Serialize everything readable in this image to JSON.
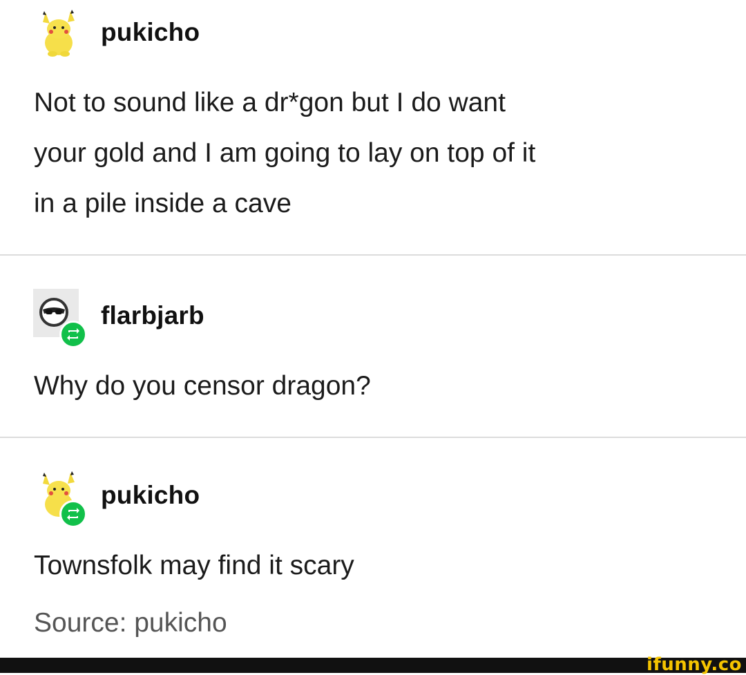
{
  "posts": [
    {
      "username": "pukicho",
      "avatar": "pikachu-plush-avatar",
      "reblogged": false,
      "text_lines": [
        "Not to sound like a dr*gon but I do want",
        "your gold and I am going to lay on top of it",
        "in a pile inside a cave"
      ]
    },
    {
      "username": "flarbjarb",
      "avatar": "sunglasses-emoji-avatar",
      "reblogged": true,
      "text_lines": [
        "Why do you censor dragon?"
      ]
    },
    {
      "username": "pukicho",
      "avatar": "pikachu-plush-avatar",
      "reblogged": true,
      "text_lines": [
        "Townsfolk may find it scary"
      ]
    }
  ],
  "source": "Source: pukicho",
  "watermark": "ifunny.co",
  "colors": {
    "reblog_badge": "#11c04a",
    "divider": "#dcdcdc",
    "watermark": "#f5c400",
    "footer": "#111111"
  }
}
